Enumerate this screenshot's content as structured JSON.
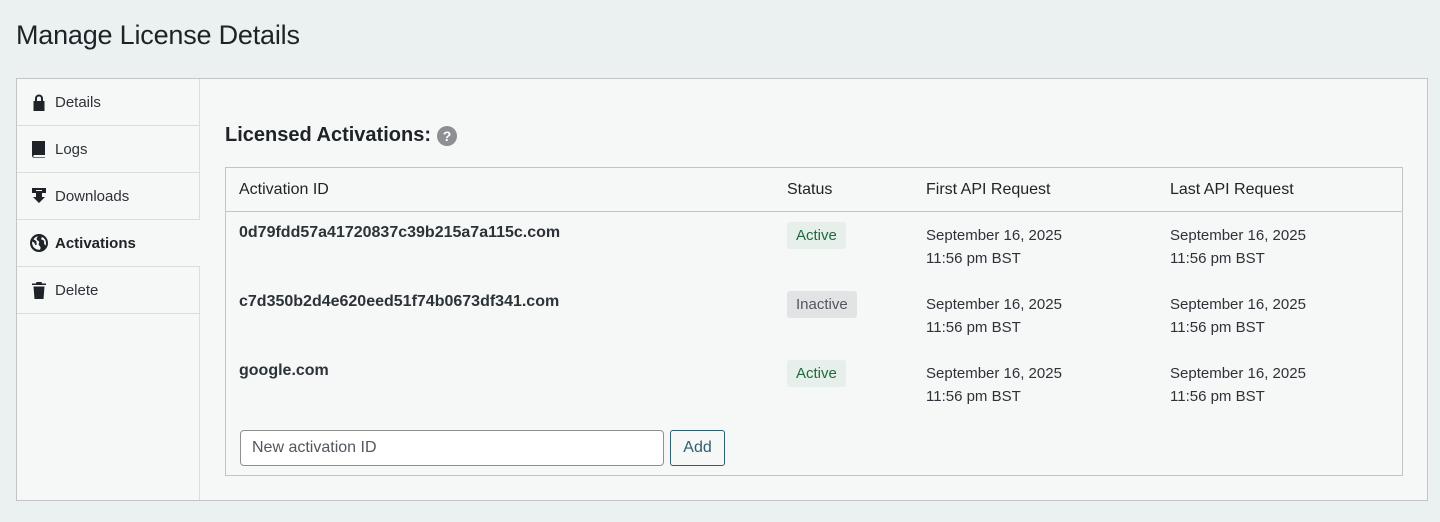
{
  "page": {
    "title": "Manage License Details"
  },
  "sidebar": {
    "tabs": [
      {
        "label": "Details",
        "icon": "lock-icon",
        "active": false
      },
      {
        "label": "Logs",
        "icon": "book-icon",
        "active": false
      },
      {
        "label": "Downloads",
        "icon": "download-icon",
        "active": false
      },
      {
        "label": "Activations",
        "icon": "globe-icon",
        "active": true
      },
      {
        "label": "Delete",
        "icon": "trash-icon",
        "active": false
      }
    ]
  },
  "activations": {
    "heading": "Licensed Activations:",
    "help_icon": "?",
    "columns": {
      "id": "Activation ID",
      "status": "Status",
      "first": "First API Request",
      "last": "Last API Request"
    },
    "rows": [
      {
        "id": "0d79fdd57a41720837c39b215a7a115c.com",
        "status": "Active",
        "first_date": "September 16, 2025",
        "first_time": "11:56 pm BST",
        "last_date": "September 16, 2025",
        "last_time": "11:56 pm BST"
      },
      {
        "id": "c7d350b2d4e620eed51f74b0673df341.com",
        "status": "Inactive",
        "first_date": "September 16, 2025",
        "first_time": "11:56 pm BST",
        "last_date": "September 16, 2025",
        "last_time": "11:56 pm BST"
      },
      {
        "id": "google.com",
        "status": "Active",
        "first_date": "September 16, 2025",
        "first_time": "11:56 pm BST",
        "last_date": "September 16, 2025",
        "last_time": "11:56 pm BST"
      }
    ],
    "new_input": {
      "placeholder": "New activation ID",
      "value": ""
    },
    "add_label": "Add"
  },
  "colors": {
    "background": "#ebf1f0",
    "panel": "#f6f7f7",
    "active_badge": "#e6efe9",
    "inactive_badge": "#e2e3e4",
    "button_accent": "#2c5f6f"
  }
}
